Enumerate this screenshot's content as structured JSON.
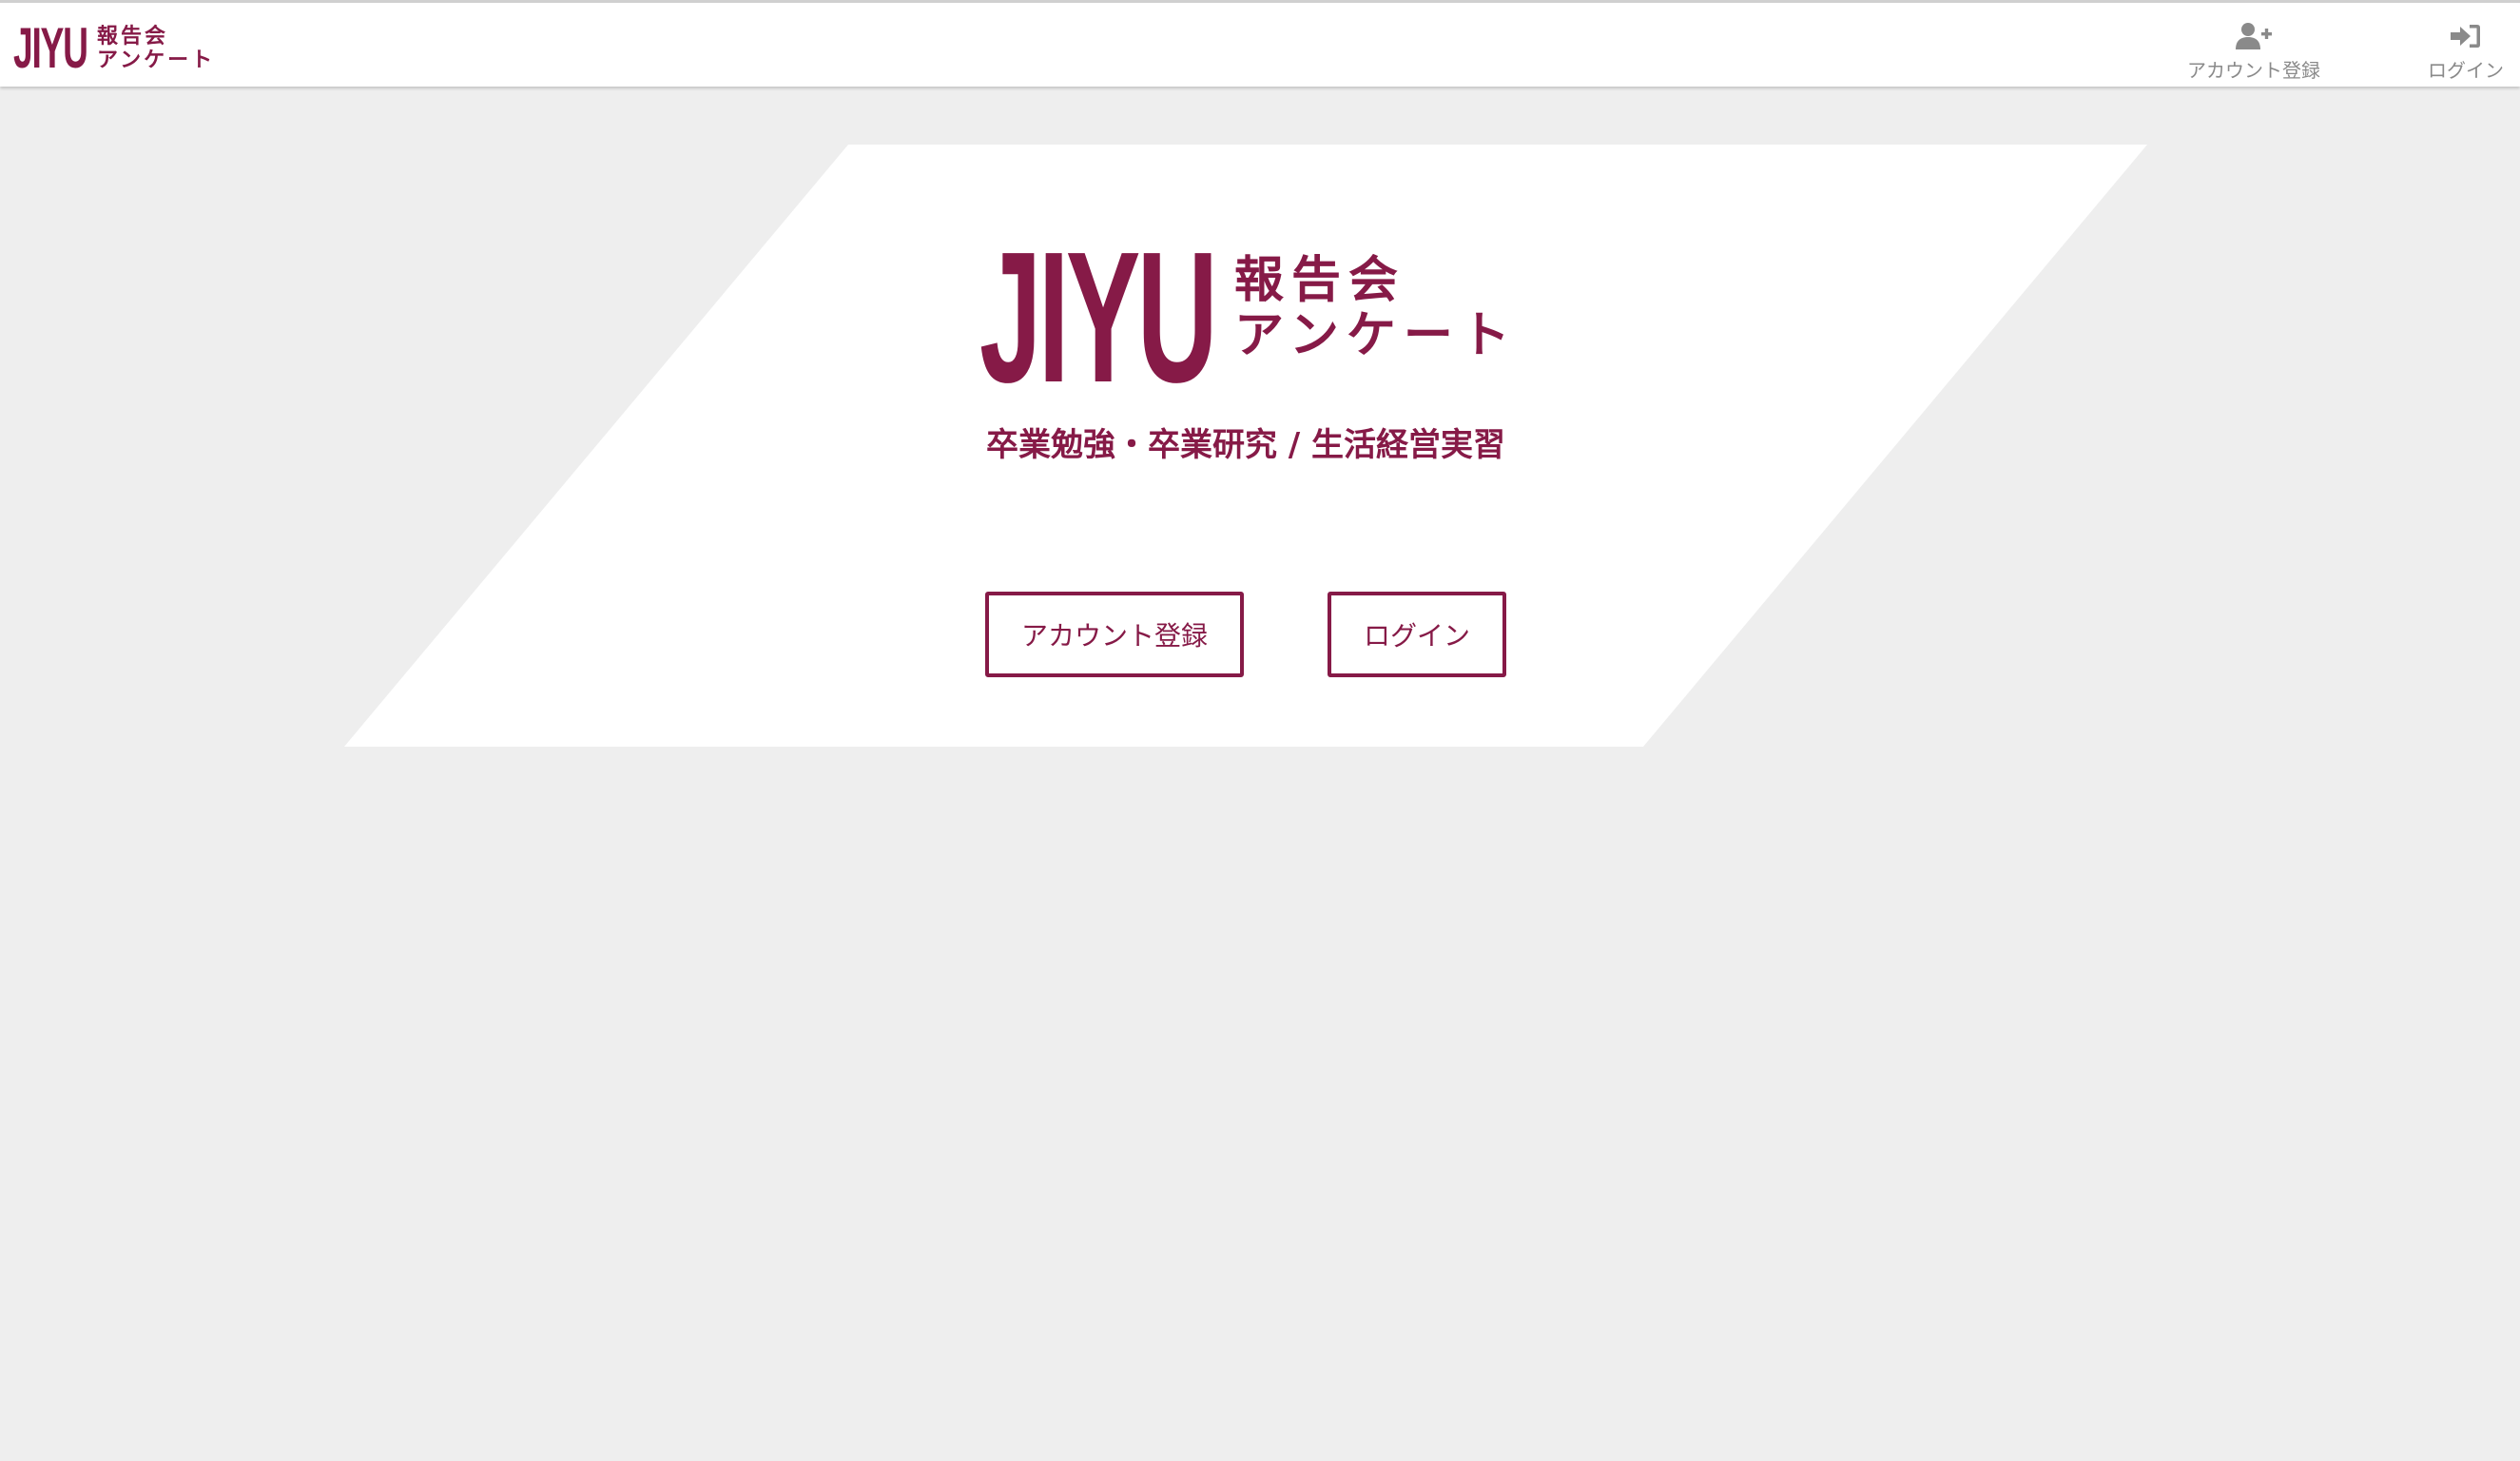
{
  "header": {
    "brand": {
      "jiyu": "JIYU",
      "line1": "報告会",
      "line2": "アンケート"
    },
    "nav": {
      "register_label": "アカウント登録",
      "login_label": "ログイン"
    }
  },
  "hero": {
    "logo": {
      "jiyu": "JIYU",
      "line1": "報告会",
      "line2": "アンケート"
    },
    "tagline": "卒業勉強・卒業研究 / 生活経営実習",
    "buttons": {
      "register_label": "アカウント登録",
      "login_label": "ログイン"
    }
  },
  "colors": {
    "brand": "#861a47",
    "background": "#eeeeee",
    "nav_icon": "#8a8a8a"
  },
  "icons": {
    "register": "user-plus-icon",
    "login": "sign-in-icon"
  }
}
